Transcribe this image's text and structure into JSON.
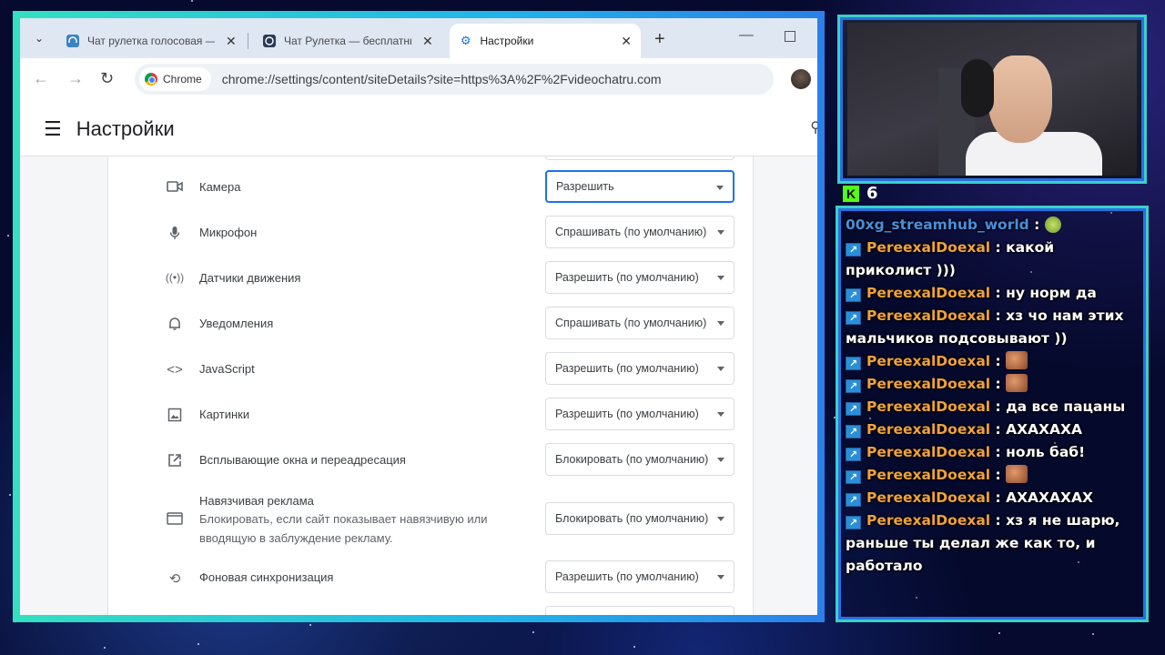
{
  "browser": {
    "tabs": [
      {
        "title": "Чат рулетка голосовая — b",
        "icon": "headset-icon",
        "active": false
      },
      {
        "title": "Чат Рулетка — бесплатный ч",
        "icon": "aperture-icon",
        "active": false
      },
      {
        "title": "Настройки",
        "icon": "gear-icon",
        "active": true
      }
    ],
    "omnibox": {
      "chip_label": "Chrome",
      "url": "chrome://settings/content/siteDetails?site=https%3A%2F%2Fvideochatru.com"
    }
  },
  "settings": {
    "title": "Настройки",
    "permissions": [
      {
        "label": "Камера",
        "icon": "camera-icon",
        "value": "Разрешить",
        "focused": true
      },
      {
        "label": "Микрофон",
        "icon": "microphone-icon",
        "value": "Спрашивать (по умолчанию)"
      },
      {
        "label": "Датчики движения",
        "icon": "sensors-icon",
        "value": "Разрешить (по умолчанию)"
      },
      {
        "label": "Уведомления",
        "icon": "bell-icon",
        "value": "Спрашивать (по умолчанию)"
      },
      {
        "label": "JavaScript",
        "icon": "code-icon",
        "value": "Разрешить (по умолчанию)"
      },
      {
        "label": "Картинки",
        "icon": "image-icon",
        "value": "Разрешить (по умолчанию)"
      },
      {
        "label": "Всплывающие окна и переадресация",
        "icon": "open-in-new-icon",
        "value": "Блокировать (по умолчанию)"
      },
      {
        "label": "Навязчивая реклама",
        "description": "Блокировать, если сайт показывает навязчивую или вводящую в заблуждение рекламу.",
        "icon": "ads-icon",
        "value": "Блокировать (по умолчанию)"
      },
      {
        "label": "Фоновая синхронизация",
        "icon": "sync-icon",
        "value": "Разрешить (по умолчанию)"
      }
    ]
  },
  "stream": {
    "viewer_count": "6",
    "chat": [
      {
        "user": "00xg_streamhub_world",
        "text": "",
        "emote": "green",
        "badge": false,
        "user_color": "blue"
      },
      {
        "user": "PereexalDoexal",
        "text": "какой приколист )))"
      },
      {
        "user": "PereexalDoexal",
        "text": "ну норм да"
      },
      {
        "user": "PereexalDoexal",
        "text": "хз чо нам этих мальчиков подсовывают ))"
      },
      {
        "user": "PereexalDoexal",
        "text": "",
        "emote": "face"
      },
      {
        "user": "PereexalDoexal",
        "text": "",
        "emote": "face"
      },
      {
        "user": "PereexalDoexal",
        "text": "да все пацаны"
      },
      {
        "user": "PereexalDoexal",
        "text": "АХАХАХА"
      },
      {
        "user": "PereexalDoexal",
        "text": "ноль баб!"
      },
      {
        "user": "PereexalDoexal",
        "text": "",
        "emote": "face"
      },
      {
        "user": "PereexalDoexal",
        "text": "АХАХАХАХ"
      },
      {
        "user": "PereexalDoexal",
        "text": "хз я не шарю, раньше ты делал же как то, и работало"
      }
    ]
  }
}
